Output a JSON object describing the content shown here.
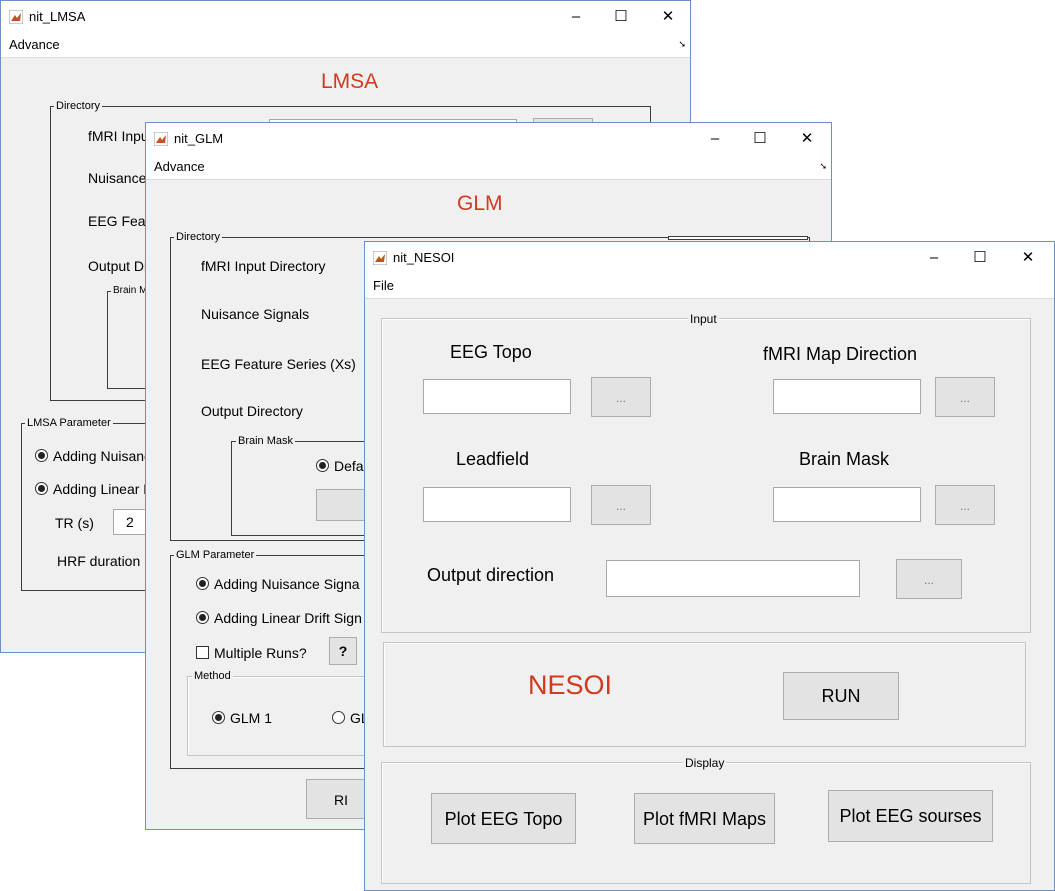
{
  "lmsa": {
    "title": "nit_LMSA",
    "menu": "Advance",
    "heading": "LMSA",
    "directory_group": "Directory",
    "fmri_label": "fMRI Input",
    "nuisance_label": "Nuisance",
    "eeg_label": "EEG Fea",
    "output_label": "Output Di",
    "brain_mask_group": "Brain M",
    "param_group": "LMSA Parameter",
    "radio_nuisance": "Adding Nuisanc",
    "radio_drift": "Adding Linear D",
    "tr_label": "TR (s)",
    "tr_value": "2",
    "hrf_label": "HRF duration ("
  },
  "glm": {
    "title": "nit_GLM",
    "menu": "Advance",
    "heading": "GLM",
    "directory_group": "Directory",
    "fmri_label": "fMRI Input Directory",
    "nuisance_label": "Nuisance Signals",
    "eeg_label": "EEG Feature Series (Xs)",
    "output_label": "Output Directory",
    "brain_mask_group": "Brain Mask",
    "brain_mask_default": "Defa",
    "param_group": "GLM Parameter",
    "radio_nuisance": "Adding Nuisance Signa",
    "radio_drift": "Adding Linear Drift Sign",
    "multiple_runs": "Multiple Runs?",
    "help_button": "?",
    "method_group": "Method",
    "method_glm1": "GLM 1",
    "method_other": "GL",
    "run_button": "RI"
  },
  "nesoi": {
    "title": "nit_NESOI",
    "menu": "File",
    "input_group": "Input",
    "eeg_topo_label": "EEG Topo",
    "fmri_map_label": "fMRI Map Direction",
    "leadfield_label": "Leadfield",
    "brain_mask_label": "Brain Mask",
    "output_label": "Output direction",
    "browse_label": "...",
    "nesoi_label": "NESOI",
    "run_button": "RUN",
    "display_group": "Display",
    "plot_eeg_topo": "Plot EEG Topo",
    "plot_fmri_maps": "Plot fMRI Maps",
    "plot_eeg_sources": "Plot EEG sourses"
  },
  "window_controls": {
    "minimize": "–",
    "maximize": "☐",
    "close": "✕"
  },
  "colors": {
    "heading_red": "#d03a1f",
    "border_blue": "#6b8fc7"
  }
}
